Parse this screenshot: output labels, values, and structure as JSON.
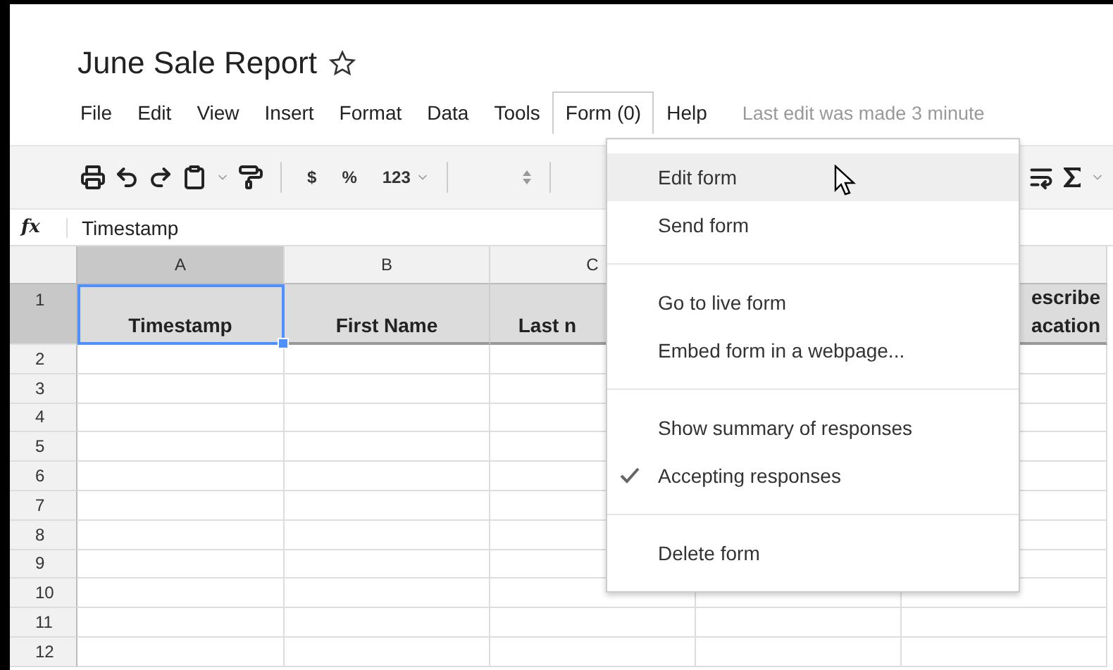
{
  "document": {
    "title": "June Sale Report",
    "starred": false
  },
  "menu": [
    {
      "label": "File",
      "selected": false
    },
    {
      "label": "Edit",
      "selected": false
    },
    {
      "label": "View",
      "selected": false
    },
    {
      "label": "Insert",
      "selected": false
    },
    {
      "label": "Format",
      "selected": false
    },
    {
      "label": "Data",
      "selected": false
    },
    {
      "label": "Tools",
      "selected": false
    },
    {
      "label": "Form (0)",
      "selected": true
    },
    {
      "label": "Help",
      "selected": false
    }
  ],
  "last_edit": "Last edit was made 3 minute",
  "toolbar": {
    "currency": "$",
    "percent": "%",
    "number_format": "123"
  },
  "formula_bar": {
    "label": "fx",
    "value": "Timestamp"
  },
  "sheet": {
    "columns": [
      {
        "label": "A",
        "selected": true
      },
      {
        "label": "B",
        "selected": false
      },
      {
        "label": "C",
        "selected": false
      }
    ],
    "header_row": {
      "number": "1",
      "selected": true,
      "cells": [
        {
          "text": "Timestamp",
          "selected": true
        },
        {
          "text": "First Name",
          "selected": false
        },
        {
          "text": "Last n",
          "selected": false
        },
        {
          "text": "escribe\nacation",
          "selected": false
        }
      ]
    },
    "row_numbers": [
      "2",
      "3",
      "4",
      "5",
      "6",
      "7",
      "8",
      "9",
      "10",
      "11",
      "12"
    ]
  },
  "form_menu": {
    "groups": [
      {
        "items": [
          {
            "label": "Edit form",
            "selected": true,
            "checked": false
          },
          {
            "label": "Send form",
            "selected": false,
            "checked": false
          }
        ]
      },
      {
        "items": [
          {
            "label": "Go to live form",
            "selected": false,
            "checked": false
          },
          {
            "label": "Embed form in a webpage...",
            "selected": false,
            "checked": false
          }
        ]
      },
      {
        "items": [
          {
            "label": "Show summary of responses",
            "selected": false,
            "checked": false
          },
          {
            "label": "Accepting responses",
            "selected": false,
            "checked": true
          }
        ]
      },
      {
        "items": [
          {
            "label": "Delete form",
            "selected": false,
            "checked": false
          }
        ]
      }
    ]
  }
}
